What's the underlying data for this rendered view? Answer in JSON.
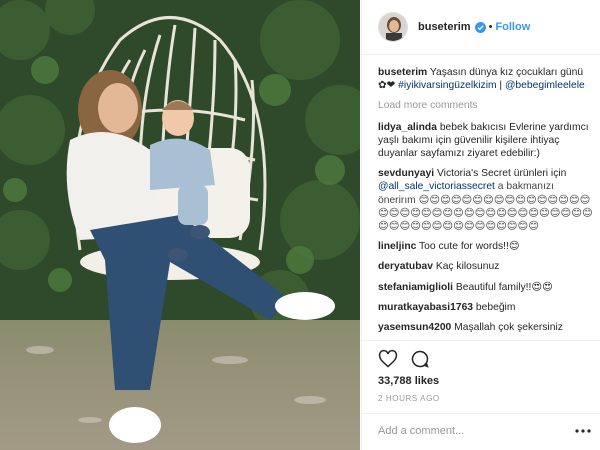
{
  "header": {
    "username": "buseterim",
    "separator": "•",
    "follow_label": "Follow"
  },
  "caption": {
    "user": "buseterim",
    "text": "Yaşasın dünya kız çocukları günü ✿❤",
    "hashtag": "#iyikivarsingüzelkizim",
    "pipe": " |",
    "mention": "@bebegimleelele"
  },
  "load_more": "Load more comments",
  "comments": [
    {
      "user": "lidya_alinda",
      "text": "bebek bakıcısı Evlerine yardımcı yaşlı bakımı için güvenilir kişilere ihtiyaç duyanlar sayfamızı ziyaret edebilir:)"
    },
    {
      "user": "sevdunyayi",
      "text": "Victoria's Secret ürünleri için",
      "mention": "@all_sale_victoriassecret",
      "text2": "a bakmanızı önerirım 😊😊😊😊😊😊😊😊😊😊😊😊😊😊😊😊😊😊😊😊😊😊😊😊😊😊😊😊😊😊😊😊😊😊😊😊😊😊😊😊😊😊😊😊😊😊😊😊😊😊😊"
    },
    {
      "user": "lineljinc",
      "text": "Too cute for words!!😊"
    },
    {
      "user": "deryatubav",
      "text": "Kaç kilosunuz"
    },
    {
      "user": "stefaniamiglioli",
      "text": "Beautiful family!!😍😍"
    },
    {
      "user": "muratkayabasi1763",
      "text": "bebeğim"
    },
    {
      "user": "yasemsun4200",
      "text": "Maşallah çok şekersiniz"
    }
  ],
  "stats": {
    "likes": "33,788 likes",
    "time": "2 HOURS AGO"
  },
  "add_comment": {
    "placeholder": "Add a comment..."
  },
  "icons": [
    "verified-icon",
    "heart-icon",
    "comment-icon",
    "more-options-icon"
  ],
  "colors": {
    "follow": "#3897f0",
    "link": "#003569",
    "muted": "#999999",
    "verified": "#3897f0"
  }
}
